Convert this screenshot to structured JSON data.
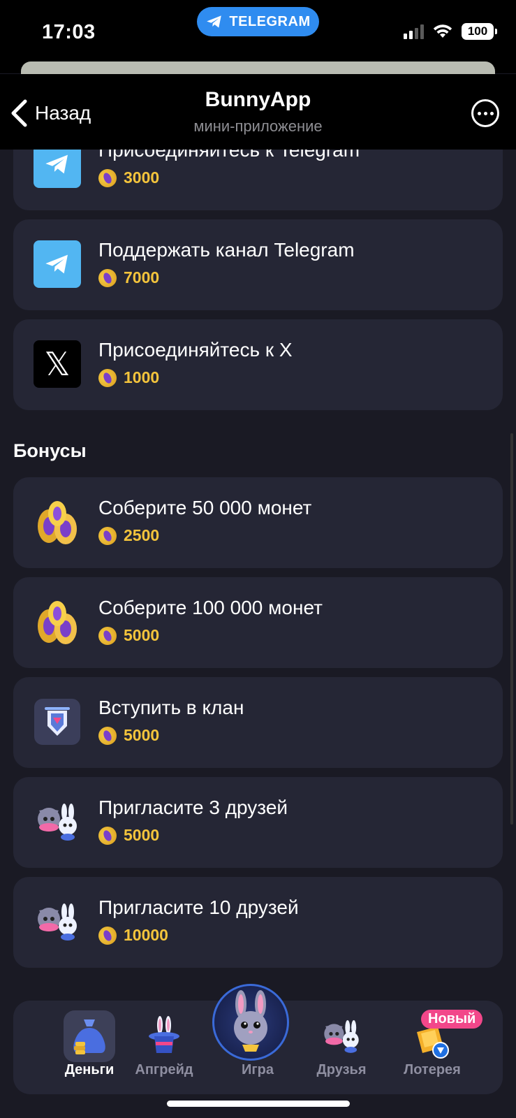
{
  "status_bar": {
    "time": "17:03",
    "pill_label": "TELEGRAM",
    "battery": "100"
  },
  "header": {
    "back_label": "Назад",
    "title": "BunnyApp",
    "subtitle": "мини-приложение"
  },
  "tasks": [
    {
      "title": "Присоединяйтесь к Telegram",
      "reward": "3000",
      "icon": "telegram-icon"
    },
    {
      "title": "Поддержать канал Telegram",
      "reward": "7000",
      "icon": "telegram-icon"
    },
    {
      "title": "Присоединяйтесь к X",
      "reward": "1000",
      "icon": "x-icon"
    }
  ],
  "bonuses_title": "Бонусы",
  "bonuses": [
    {
      "title": "Соберите 50 000 монет",
      "reward": "2500",
      "icon": "coins-pile-icon"
    },
    {
      "title": "Соберите 100 000 монет",
      "reward": "5000",
      "icon": "coins-pile-icon"
    },
    {
      "title": "Вступить в клан",
      "reward": "5000",
      "icon": "clan-shield-icon"
    },
    {
      "title": "Пригласите 3 друзей",
      "reward": "5000",
      "icon": "friends-icon"
    },
    {
      "title": "Пригласите 10 друзей",
      "reward": "10000",
      "icon": "friends-icon"
    }
  ],
  "bottom_nav": {
    "tabs": [
      {
        "label": "Деньги",
        "icon": "money-bag-icon",
        "active": true
      },
      {
        "label": "Апгрейд",
        "icon": "magic-hat-icon"
      },
      {
        "label": "Игра",
        "icon": "bunny-avatar-icon"
      },
      {
        "label": "Друзья",
        "icon": "friends-icon"
      },
      {
        "label": "Лотерея",
        "icon": "ticket-icon"
      }
    ],
    "new_badge": "Новый"
  },
  "colors": {
    "background": "#1a1a24",
    "card": "#252635",
    "reward": "#f4c43c",
    "telegram": "#52b6f2",
    "badge": "#f2478a"
  }
}
